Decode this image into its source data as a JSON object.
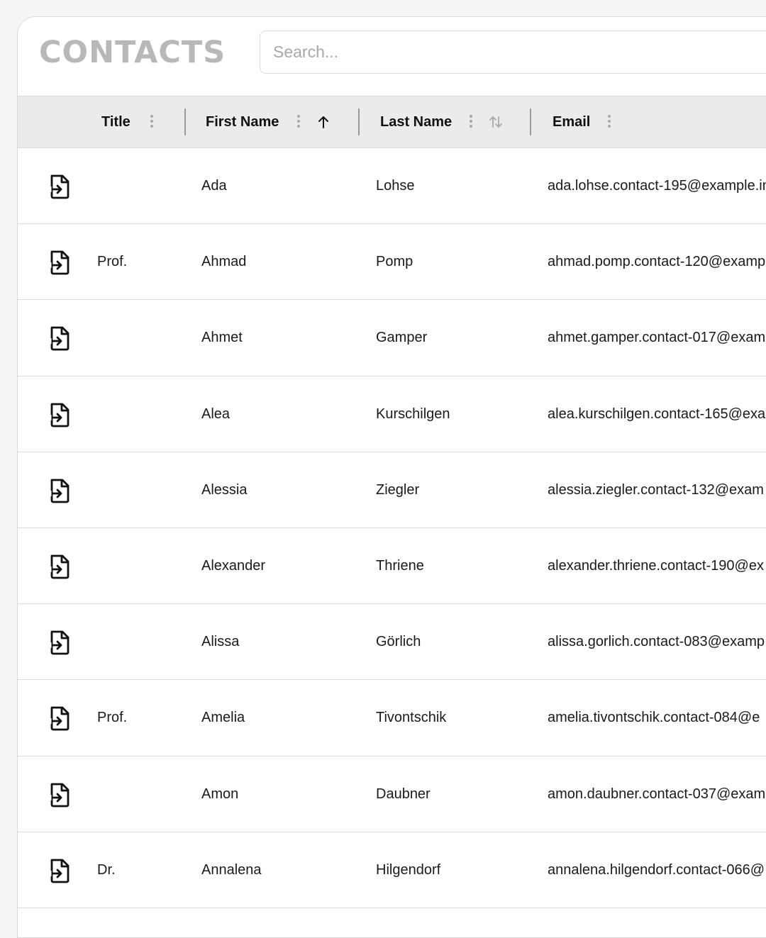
{
  "app": {
    "title": "CONTACTS"
  },
  "search": {
    "placeholder": "Search..."
  },
  "columns": [
    {
      "key": "title",
      "label": "Title"
    },
    {
      "key": "first_name",
      "label": "First Name",
      "sort": "ascending"
    },
    {
      "key": "last_name",
      "label": "Last Name",
      "sort": "unsorted"
    },
    {
      "key": "email",
      "label": "Email"
    }
  ],
  "icons": {
    "row_action": "file-export-icon",
    "column_menu": "kebab-menu-icon",
    "sort_asc": "arrow-up-icon",
    "sort_none": "sort-arrows-icon"
  },
  "colors": {
    "header_bg": "#ebebeb",
    "title_color": "#b8b8b8",
    "border": "#dcdcdc"
  },
  "rows": [
    {
      "title": "",
      "first_name": "Ada",
      "last_name": "Lohse",
      "email": "ada.lohse.contact-195@example.in"
    },
    {
      "title": "Prof.",
      "first_name": "Ahmad",
      "last_name": "Pomp",
      "email": "ahmad.pomp.contact-120@examp"
    },
    {
      "title": "",
      "first_name": "Ahmet",
      "last_name": "Gamper",
      "email": "ahmet.gamper.contact-017@exam"
    },
    {
      "title": "",
      "first_name": "Alea",
      "last_name": "Kurschilgen",
      "email": "alea.kurschilgen.contact-165@exa"
    },
    {
      "title": "",
      "first_name": "Alessia",
      "last_name": "Ziegler",
      "email": "alessia.ziegler.contact-132@exam"
    },
    {
      "title": "",
      "first_name": "Alexander",
      "last_name": "Thriene",
      "email": "alexander.thriene.contact-190@ex"
    },
    {
      "title": "",
      "first_name": "Alissa",
      "last_name": "Görlich",
      "email": "alissa.gorlich.contact-083@examp"
    },
    {
      "title": "Prof.",
      "first_name": "Amelia",
      "last_name": "Tivontschik",
      "email": "amelia.tivontschik.contact-084@e"
    },
    {
      "title": "",
      "first_name": "Amon",
      "last_name": "Daubner",
      "email": "amon.daubner.contact-037@exam"
    },
    {
      "title": "Dr.",
      "first_name": "Annalena",
      "last_name": "Hilgendorf",
      "email": "annalena.hilgendorf.contact-066@"
    }
  ]
}
